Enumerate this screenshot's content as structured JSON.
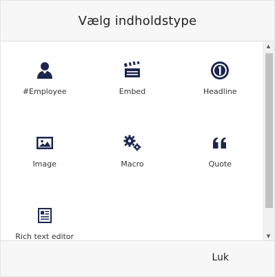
{
  "dialog": {
    "title": "Vælg indholdstype",
    "close_label": "Luk"
  },
  "items": [
    {
      "label": "#Employee",
      "icon": "user-icon"
    },
    {
      "label": "Embed",
      "icon": "clapperboard-icon"
    },
    {
      "label": "Headline",
      "icon": "number-one-circle-icon"
    },
    {
      "label": "Image",
      "icon": "picture-icon"
    },
    {
      "label": "Macro",
      "icon": "gears-icon"
    },
    {
      "label": "Quote",
      "icon": "quote-icon"
    },
    {
      "label": "Rich text editor",
      "icon": "article-icon"
    }
  ],
  "colors": {
    "icon": "#1b264f",
    "header_bg": "#f7f7f7",
    "scroll_thumb": "#c1c1c1"
  }
}
